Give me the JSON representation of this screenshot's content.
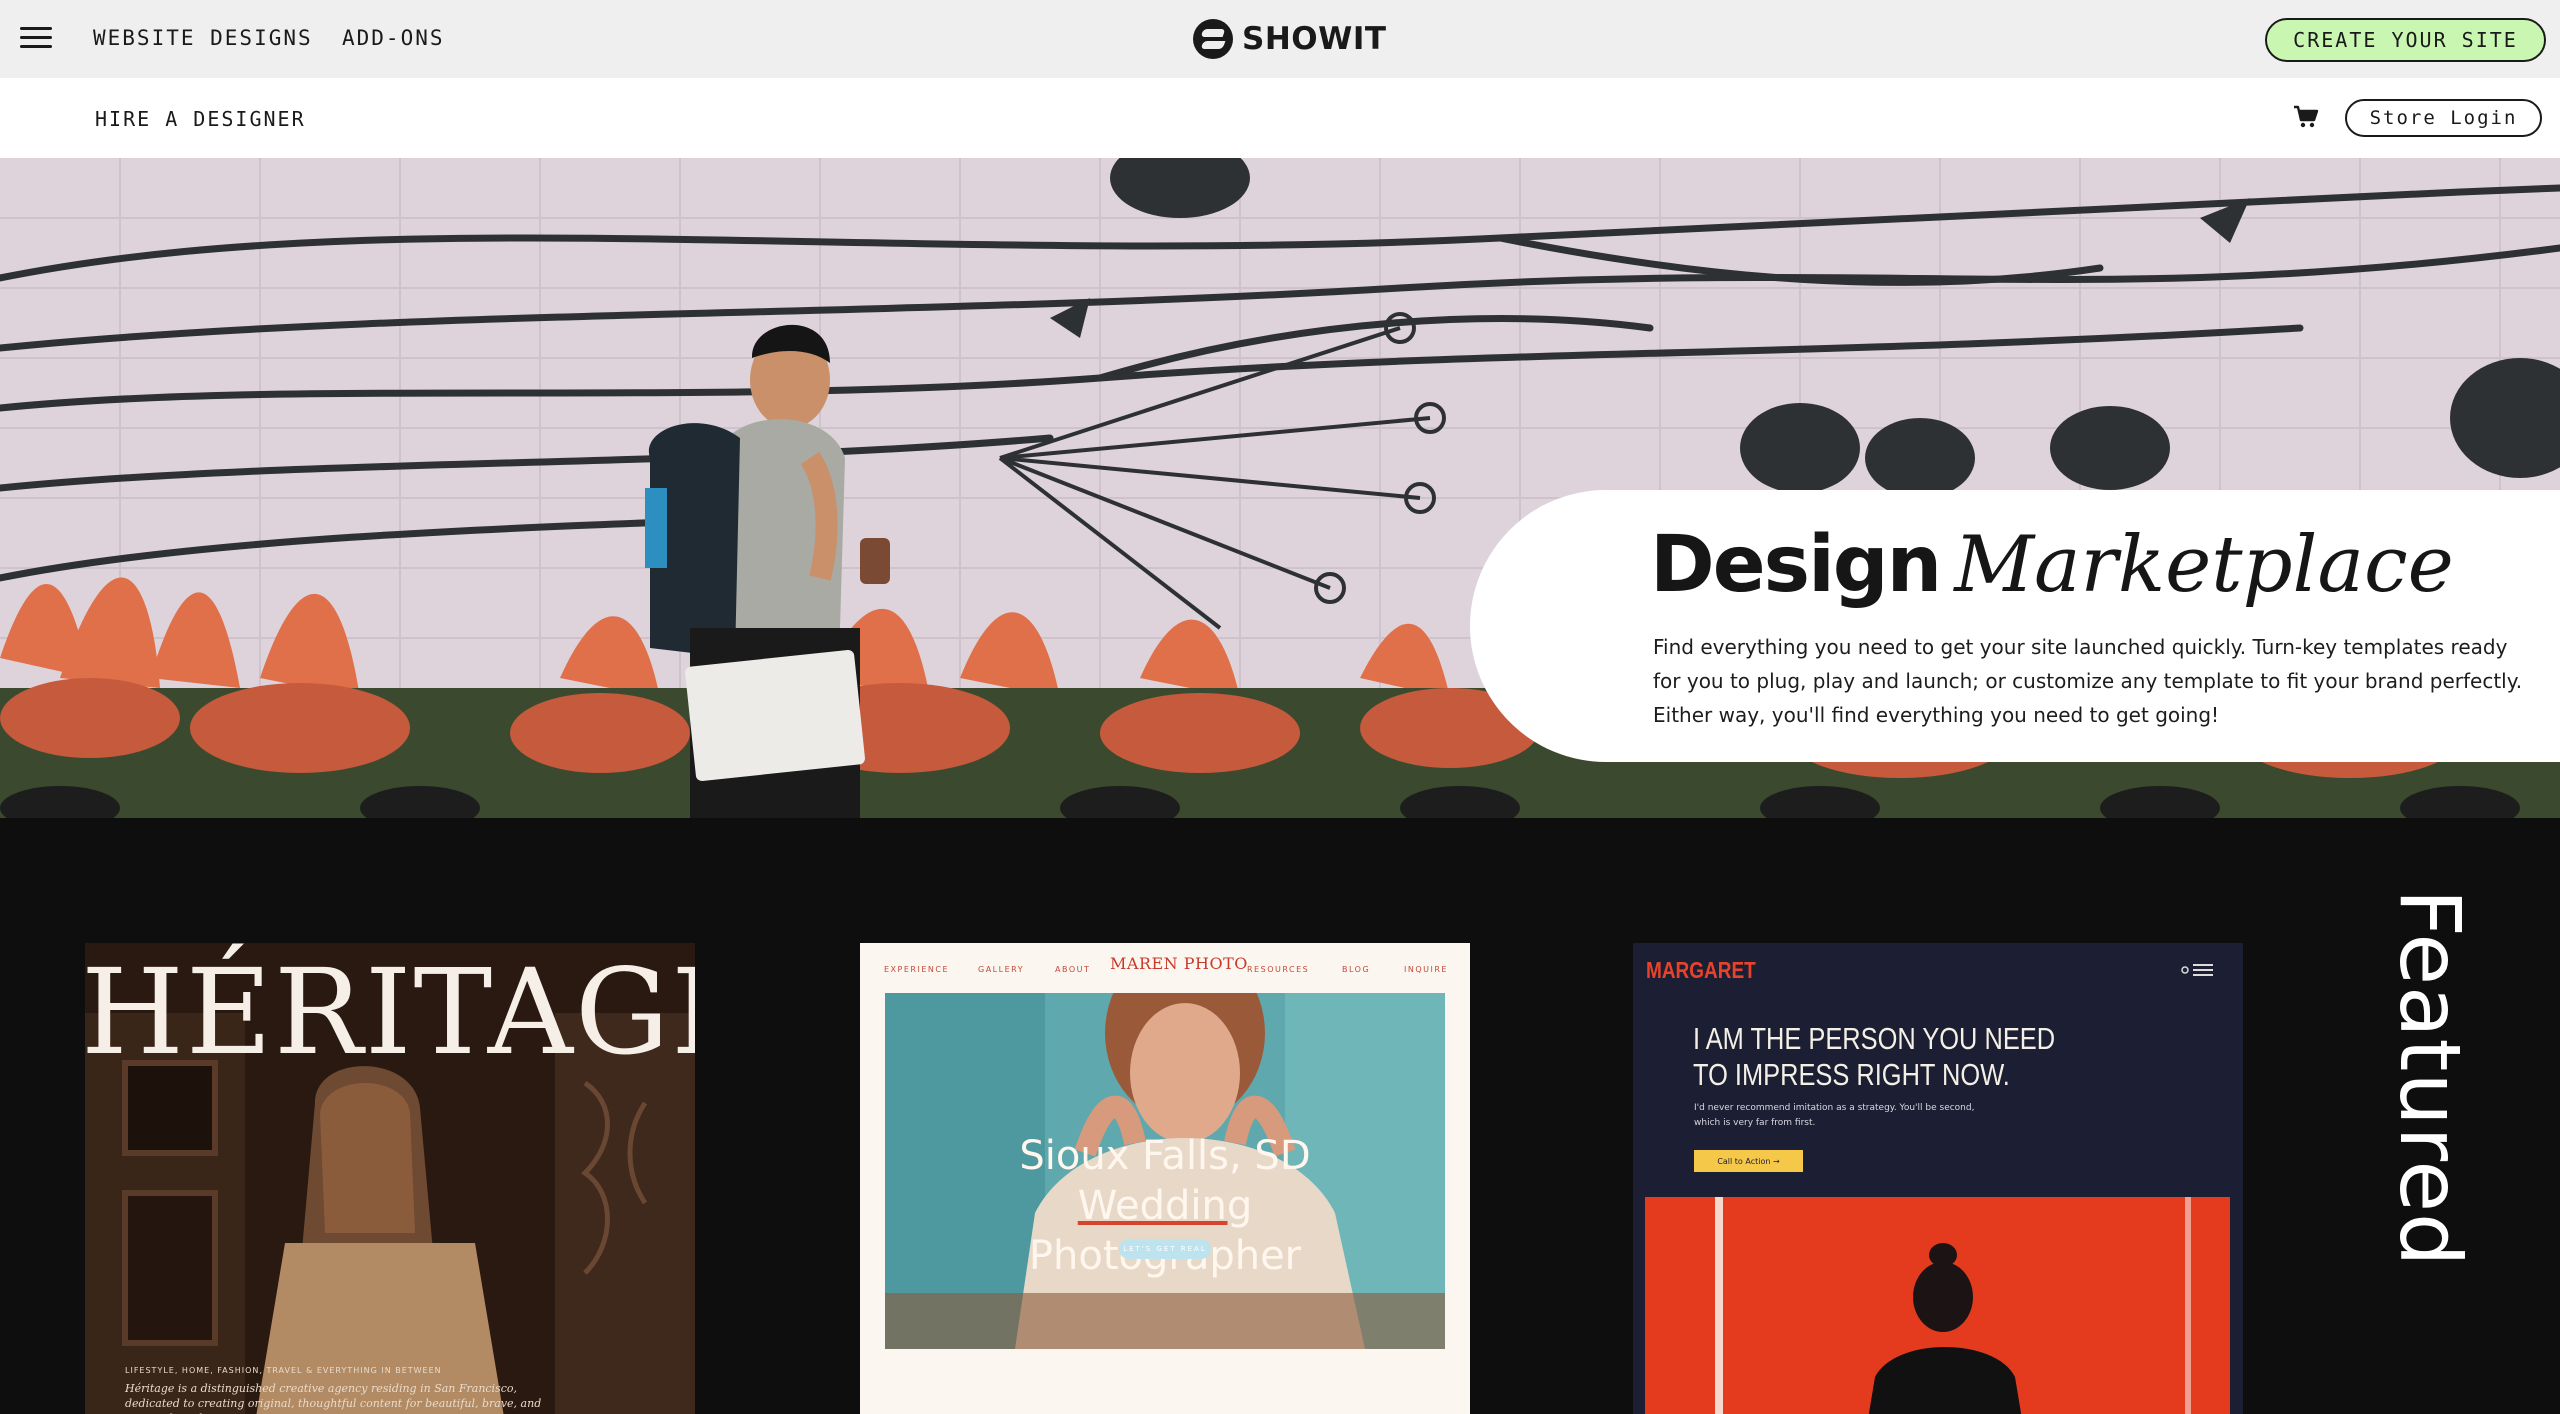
{
  "topnav": {
    "menu_icon": "hamburger-menu-icon",
    "website_designs": "WEBSITE DESIGNS",
    "add_ons": "ADD-ONS",
    "brand": "SHOWIT",
    "cta": "CREATE YOUR SITE"
  },
  "subnav": {
    "hire": "HIRE A DESIGNER",
    "cart_icon": "shopping-cart-icon",
    "store_login": "Store Login"
  },
  "hero": {
    "title_sans": "Design",
    "title_serif": "Marketplace",
    "description": "Find everything you need to get your site launched quickly. Turn-key templates ready for you to plug, play and launch; or customize any template to fit your brand perfectly. Either way, you'll find everything you need to get going!"
  },
  "featured": {
    "label": "Featured",
    "cards": [
      {
        "title": "HÉRITAGE",
        "tagline": "LIFESTYLE, HOME, FASHION, TRAVEL & EVERYTHING IN BETWEEN",
        "description": "Héritage is a distinguished creative agency residing in San Francisco, dedicated to creating original, thoughtful content for beautiful, brave, and sincere brands."
      },
      {
        "logo": "MAREN PHOTO",
        "nav": [
          "EXPERIENCE",
          "GALLERY",
          "ABOUT",
          "RESOURCES",
          "BLOG",
          "INQUIRE"
        ],
        "headline_1": "Sioux Falls, SD",
        "headline_2": "Wedding",
        "headline_3": "Photographer",
        "button": "LET'S GET REAL"
      },
      {
        "logo": "MARGARET",
        "headline": "I AM THE PERSON YOU NEED TO IMPRESS RIGHT NOW.",
        "subtext": "I'd never recommend imitation as a strategy. You'll be second, which is very far from first.",
        "button": "Call to Action →"
      }
    ]
  },
  "colors": {
    "cta_green": "#c9f7b2",
    "featured_bg": "#0e0e0e",
    "hero_wall": "#ded3da"
  }
}
